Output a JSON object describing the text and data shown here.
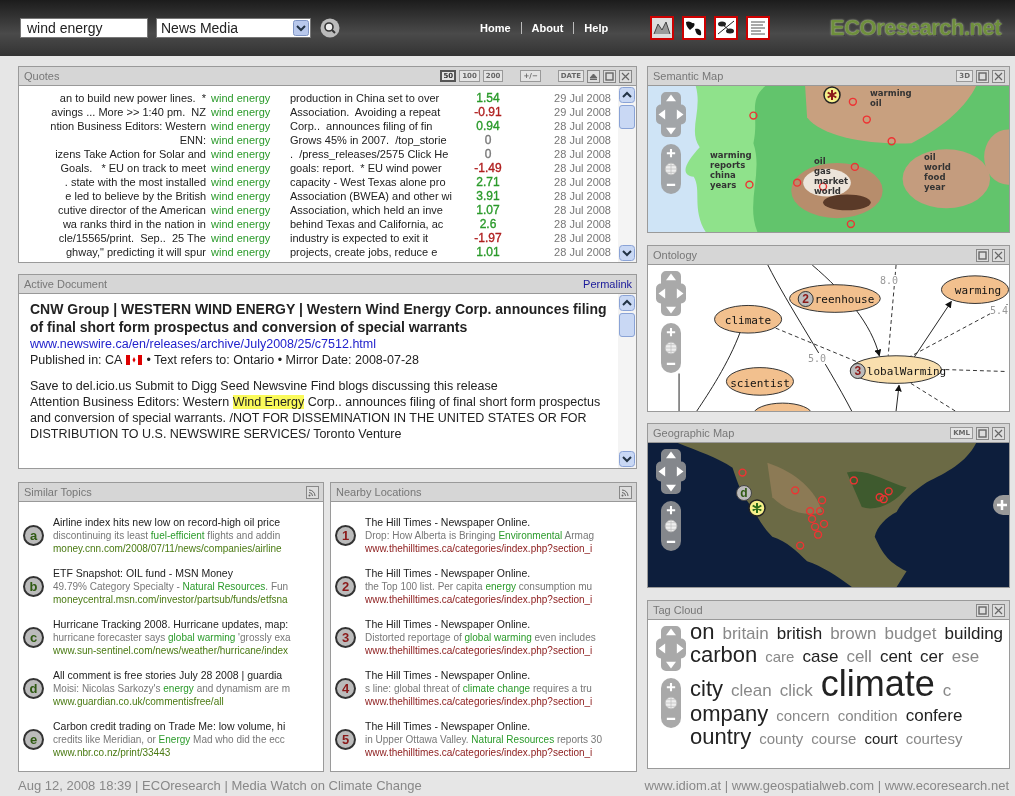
{
  "header": {
    "search": {
      "value": "wind energy"
    },
    "source_select": {
      "value": "News Media"
    },
    "nav": [
      "Home",
      "About",
      "Help"
    ],
    "logo": "ECOresearch.net"
  },
  "quotes": {
    "title": "Quotes",
    "limit_buttons": [
      {
        "label": "50",
        "selected": true
      },
      {
        "label": "100",
        "selected": false
      },
      {
        "label": "200",
        "selected": false
      }
    ],
    "toggle_button": "+/−",
    "sort_button": "DATE",
    "rows": [
      {
        "before": "an to build new power lines.  *",
        "keyword": "wind energy",
        "after": "production in China set to over",
        "change": "1.54",
        "color": "#2a9a2a",
        "date": "29 Jul 2008"
      },
      {
        "before": "avings ... More >> 1:40 pm.  NZ",
        "keyword": "wind energy",
        "after": "Association.  Avoiding a repeat",
        "change": "-0.91",
        "color": "#b02020",
        "date": "29 Jul 2008"
      },
      {
        "before": "ntion Business Editors: Western",
        "keyword": "wind energy",
        "after": "Corp..  announces filing of fin",
        "change": "0.94",
        "color": "#2a9a2a",
        "date": "28 Jul 2008"
      },
      {
        "before": "ENN:",
        "keyword": "wind energy",
        "after": "Grows 45% in 2007.  /top_storie",
        "change": "0",
        "color": "#777777",
        "date": "28 Jul 2008"
      },
      {
        "before": "izens Take Action for Solar and",
        "keyword": "wind energy",
        "after": ".  /press_releases/2575 Click He",
        "change": "0",
        "color": "#777777",
        "date": "28 Jul 2008"
      },
      {
        "before": "Goals.   * EU on track to meet",
        "keyword": "wind energy",
        "after": "goals: report.  * EU wind power",
        "change": "-1.49",
        "color": "#b02020",
        "date": "28 Jul 2008"
      },
      {
        "before": ". state with the most installed",
        "keyword": "wind energy",
        "after": "capacity - West Texas alone pro",
        "change": "2.71",
        "color": "#2a9a2a",
        "date": "28 Jul 2008"
      },
      {
        "before": "e led to believe by the British",
        "keyword": "wind energy",
        "after": "Association (BWEA) and other wi",
        "change": "3.91",
        "color": "#2a9a2a",
        "date": "28 Jul 2008"
      },
      {
        "before": "cutive director of the American",
        "keyword": "wind energy",
        "after": "Association, which held an inve",
        "change": "1.07",
        "color": "#2a9a2a",
        "date": "28 Jul 2008"
      },
      {
        "before": "wa ranks third in the nation in",
        "keyword": "wind energy",
        "after": "behind Texas and California, ac",
        "change": "2.6",
        "color": "#2a9a2a",
        "date": "28 Jul 2008"
      },
      {
        "before": "cle/15565/print.  Sep..  25 The",
        "keyword": "wind energy",
        "after": "industry is expected to exit it",
        "change": "-1.97",
        "color": "#b02020",
        "date": "28 Jul 2008"
      },
      {
        "before": "ghway,\" predicting it will spur",
        "keyword": "wind energy",
        "after": "projects, create jobs, reduce e",
        "change": "1.01",
        "color": "#2a9a2a",
        "date": "28 Jul 2008"
      }
    ]
  },
  "active_document": {
    "title": "Active Document",
    "permalink": "Permalink",
    "headline": "CNW Group | WESTERN WIND ENERGY | Western Wind Energy Corp. announces filing of final short form prospectus and conversion of special warrants",
    "url": "www.newswire.ca/en/releases/archive/July2008/25/c7512.html",
    "published": "Published in: CA",
    "meta": "• Text refers to: Ontario • Mirror Date: 2008-07-28",
    "lead": "Save to del.icio.us Submit to Digg Seed Newsvine Find blogs discussing this release",
    "body_before": "Attention Business Editors: Western ",
    "highlight": "Wind Energy",
    "body_after": " Corp.. announces filing of final short form prospectus and conversion of special warrants. /NOT FOR DISSEMINATION IN THE UNITED STATES OR FOR DISTRIBUTION TO U.S. NEWSWIRE SERVICES/ Toronto Venture"
  },
  "similar_topics": {
    "title": "Similar Topics",
    "kind": "letters",
    "items": [
      {
        "marker": "a",
        "title": "Airline index hits new low on record-high oil price",
        "snippet_before": "discontinuing its least ",
        "keyword": "fuel-efficient",
        "snippet_after": " flights and addin",
        "url": "money.cnn.com/2008/07/11/news/companies/airline"
      },
      {
        "marker": "b",
        "title": "ETF Snapshot: OIL fund - MSN Money",
        "snippet_before": "49.79% Category Specialty - ",
        "keyword": "Natural Resources",
        "snippet_after": ". Fun",
        "url": "moneycentral.msn.com/investor/partsub/funds/etfsna"
      },
      {
        "marker": "c",
        "title": "Hurricane Tracking 2008. Hurricane updates, map:",
        "snippet_before": "hurricane forecaster says ",
        "keyword": "global warming",
        "snippet_after": " 'grossly exa",
        "url": "www.sun-sentinel.com/news/weather/hurricane/index"
      },
      {
        "marker": "d",
        "title": "All comment is free stories  July 28 2008 | guardia",
        "snippet_before": "Moisi: Nicolas Sarkozy's ",
        "keyword": "energy",
        "snippet_after": " and dynamism are m",
        "url": "www.guardian.co.uk/commentisfree/all"
      },
      {
        "marker": "e",
        "title": "Carbon credit trading on Trade Me: low volume, hi",
        "snippet_before": "credits like Meridian, or ",
        "keyword": "Energy",
        "snippet_after": " Mad who did the ecc",
        "url": "www.nbr.co.nz/print/33443"
      }
    ]
  },
  "nearby_locations": {
    "title": "Nearby Locations",
    "kind": "numbers",
    "items": [
      {
        "marker": "1",
        "title": "The Hill Times - Newspaper Online.",
        "snippet_before": "Drop: How Alberta is Bringing ",
        "keyword": "Environmental",
        "snippet_after": " Armag",
        "url": "www.thehilltimes.ca/categories/index.php?section_i"
      },
      {
        "marker": "2",
        "title": "The Hill Times - Newspaper Online.",
        "snippet_before": "the Top 100 list. Per capita ",
        "keyword": "energy",
        "snippet_after": " consumption mu",
        "url": "www.thehilltimes.ca/categories/index.php?section_i"
      },
      {
        "marker": "3",
        "title": "The Hill Times - Newspaper Online.",
        "snippet_before": "Distorted reportage of ",
        "keyword": "global warming",
        "snippet_after": " even includes",
        "url": "www.thehilltimes.ca/categories/index.php?section_i"
      },
      {
        "marker": "4",
        "title": "The Hill Times - Newspaper Online.",
        "snippet_before": "s line: global threat of ",
        "keyword": "climate change",
        "snippet_after": " requires a tru",
        "url": "www.thehilltimes.ca/categories/index.php?section_i"
      },
      {
        "marker": "5",
        "title": "The Hill Times - Newspaper Online.",
        "snippet_before": "in Upper Ottawa Valley. ",
        "keyword": "Natural Resources",
        "snippet_after": " reports 30",
        "url": "www.thehilltimes.ca/categories/index.php?section_i"
      }
    ]
  },
  "semantic_map": {
    "title": "Semantic Map",
    "button": "3D",
    "clusters": [
      [
        "warming",
        "oil"
      ],
      [
        "warming",
        "reports",
        "china",
        "years"
      ],
      [
        "oil",
        "gas",
        "market",
        "world"
      ],
      [
        "oil",
        "world",
        "food",
        "year"
      ]
    ]
  },
  "ontology": {
    "title": "Ontology",
    "nodes": [
      {
        "label": "climate"
      },
      {
        "badge": "2",
        "label": "reenhouse"
      },
      {
        "label": "warming"
      },
      {
        "label": "scientist"
      },
      {
        "badge": "3",
        "label": "lobalWarming"
      }
    ],
    "edge_labels": [
      "8.0",
      "5.0",
      "5.4"
    ]
  },
  "geographic_map": {
    "title": "Geographic Map",
    "button": "KML",
    "marker": "d"
  },
  "tag_cloud": {
    "title": "Tag Cloud",
    "tags": [
      {
        "text": "on",
        "kind": "lg",
        "faded": false
      },
      {
        "text": "britain",
        "kind": "md",
        "faded": true
      },
      {
        "text": "british",
        "kind": "md",
        "faded": false
      },
      {
        "text": "brown",
        "kind": "md",
        "faded": true
      },
      {
        "text": "budget",
        "kind": "md",
        "faded": true
      },
      {
        "text": "building",
        "kind": "md",
        "faded": false
      },
      {
        "text": "carbon",
        "kind": "lg",
        "faded": false
      },
      {
        "text": "care",
        "kind": "sm",
        "faded": true
      },
      {
        "text": "case",
        "kind": "md",
        "faded": false
      },
      {
        "text": "cell",
        "kind": "md",
        "faded": true
      },
      {
        "text": "cent",
        "kind": "md",
        "faded": false
      },
      {
        "text": "cer",
        "kind": "md",
        "faded": false
      },
      {
        "text": "ese",
        "kind": "md",
        "faded": true
      },
      {
        "text": "city",
        "kind": "lg",
        "faded": false
      },
      {
        "text": "clean",
        "kind": "md",
        "faded": true
      },
      {
        "text": "click",
        "kind": "md",
        "faded": true
      },
      {
        "text": "climate",
        "kind": "xl",
        "faded": false
      },
      {
        "text": "c",
        "kind": "md",
        "faded": true
      },
      {
        "text": "ompany",
        "kind": "lg",
        "faded": false
      },
      {
        "text": "concern",
        "kind": "sm",
        "faded": true
      },
      {
        "text": "condition",
        "kind": "sm",
        "faded": true
      },
      {
        "text": "confere",
        "kind": "md",
        "faded": false
      },
      {
        "text": "ountry",
        "kind": "lg",
        "faded": false
      },
      {
        "text": "county",
        "kind": "sm",
        "faded": true
      },
      {
        "text": "course",
        "kind": "sm",
        "faded": true
      },
      {
        "text": "court",
        "kind": "sm",
        "faded": false
      },
      {
        "text": "courtesy",
        "kind": "sm",
        "faded": true
      }
    ]
  },
  "footer": {
    "left": "Aug 12, 2008 18:39 | ECOresearch | Media Watch on Climate Change",
    "right": "www.idiom.at | www.geospatialweb.com | www.ecoresearch.net"
  }
}
